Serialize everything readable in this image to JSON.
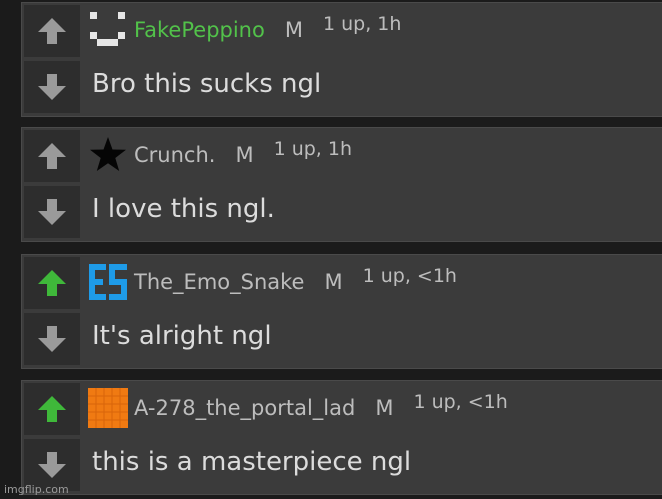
{
  "comments": [
    {
      "username": "FakePeppino",
      "badge": "M",
      "meta": "1 up, 1h",
      "text": "Bro this sucks ngl",
      "username_color": "#52c24a",
      "upvoted": false,
      "avatar_icon": "smiley-pixel-icon"
    },
    {
      "username": "Crunch.",
      "badge": "M",
      "meta": "1 up, 1h",
      "text": "I love this ngl.",
      "username_color": "#bdbdbd",
      "upvoted": false,
      "avatar_icon": "black-star-icon"
    },
    {
      "username": "The_Emo_Snake",
      "badge": "M",
      "meta": "1 up, <1h",
      "text": "It's alright ngl",
      "username_color": "#bdbdbd",
      "upvoted": true,
      "avatar_icon": "es-logo-icon"
    },
    {
      "username": "A-278_the_portal_lad",
      "badge": "M",
      "meta": "1 up, <1h",
      "text": "this is a masterpiece ngl",
      "username_color": "#bdbdbd",
      "upvoted": true,
      "avatar_icon": "orange-grid-icon"
    }
  ],
  "colors": {
    "upvote_active": "#3fb83a",
    "vote_inactive": "#9a9a9a",
    "background": "#1b1b1b",
    "card": "#3b3b3b"
  },
  "watermark": "imgflip.com"
}
